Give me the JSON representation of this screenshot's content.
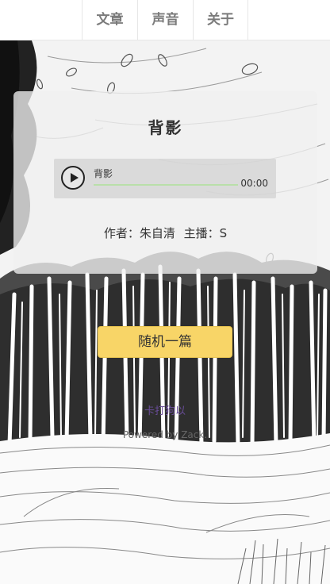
{
  "nav": {
    "tabs": [
      {
        "label": "文章"
      },
      {
        "label": "声音"
      },
      {
        "label": "关于"
      }
    ]
  },
  "card": {
    "title": "背影",
    "player": {
      "track": "背影",
      "time": "00:00",
      "progress": 0,
      "progress_color": "#b9dfa9"
    },
    "author": "作者：朱自清",
    "narrator": "主播：S"
  },
  "actions": {
    "random_label": "随机一篇",
    "random_color": "#f8d567"
  },
  "footer": {
    "link": "卡打狗以",
    "credit": "Powered by Zack."
  }
}
